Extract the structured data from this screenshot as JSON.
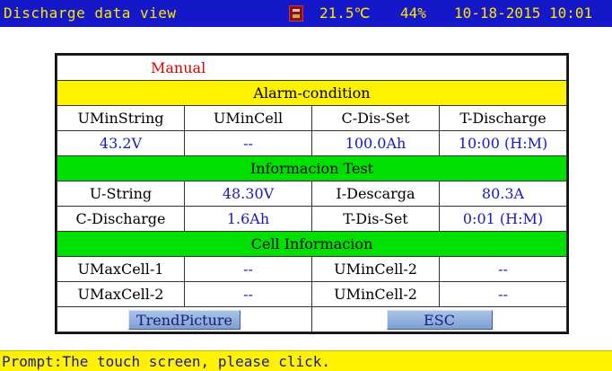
{
  "header": {
    "title": "Discharge data view",
    "temperature": "21.5℃",
    "humidity": "44%",
    "datetime": "10-18-2015 10:01",
    "status_icon": "battery-status-icon"
  },
  "mode": "Manual",
  "alarm_section": {
    "title": "Alarm-condition",
    "headers": [
      "UMinString",
      "UMinCell",
      "C-Dis-Set",
      "T-Discharge"
    ],
    "values": [
      "43.2V",
      "--",
      "100.0Ah",
      "10:00 (H:M)"
    ]
  },
  "test_section": {
    "title": "Informacion Test",
    "rows": [
      [
        "U-String",
        "48.30V",
        "I-Descarga",
        "80.3A"
      ],
      [
        "C-Discharge",
        "1.6Ah",
        "T-Dis-Set",
        "0:01 (H:M)"
      ]
    ]
  },
  "cell_section": {
    "title": "Cell Informacion",
    "rows": [
      [
        "UMaxCell-1",
        "--",
        "UMinCell-2",
        "--"
      ],
      [
        "UMaxCell-2",
        "--",
        "UMinCell-2",
        "--"
      ]
    ]
  },
  "buttons": {
    "trend": "TrendPicture",
    "esc": "ESC"
  },
  "prompt": "Prompt:The touch screen, please click.",
  "colors": {
    "topbar": "#1418c8",
    "topbar_text": "#ffe600",
    "band_yellow": "#fff200",
    "band_green": "#00e000",
    "value_text": "#1818c8",
    "mode_text": "#d80000"
  }
}
